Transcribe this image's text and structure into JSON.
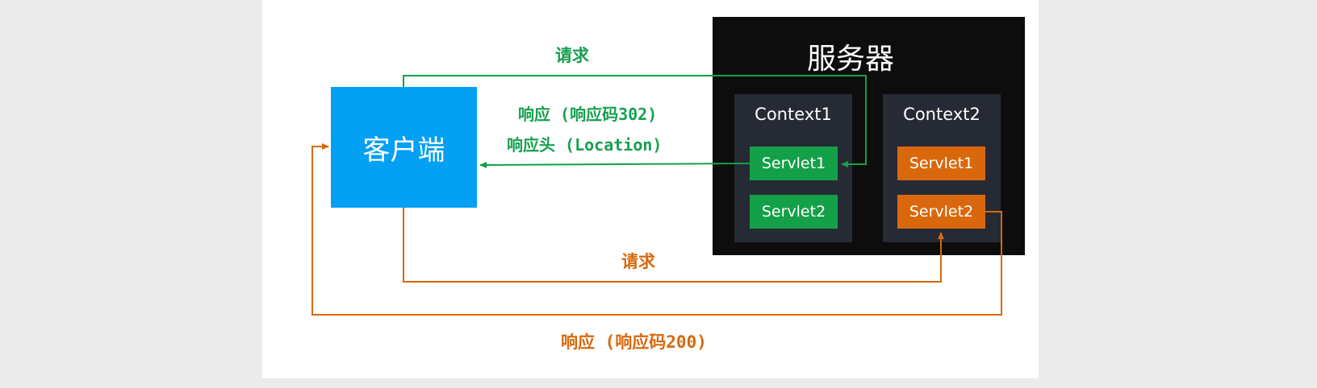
{
  "server": {
    "title": "服务器"
  },
  "client": {
    "label": "客户端"
  },
  "contexts": [
    {
      "label": "Context1",
      "servlets": [
        "Servlet1",
        "Servlet2"
      ]
    },
    {
      "label": "Context2",
      "servlets": [
        "Servlet1",
        "Servlet2"
      ]
    }
  ],
  "arrows": {
    "green_request": "请求",
    "green_response": "响应 (响应码302)",
    "green_response_header": "响应头 (Location)",
    "orange_request": "请求",
    "orange_response": "响应 (响应码200)"
  },
  "colors": {
    "green": "#14a049",
    "orange": "#d9680d",
    "client": "#03a0f3",
    "server": "#0d0d0d",
    "context": "#262a34"
  }
}
